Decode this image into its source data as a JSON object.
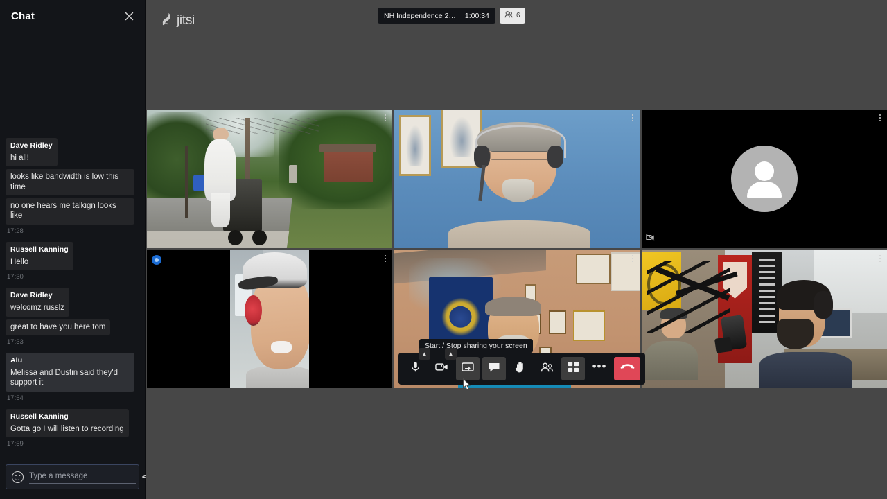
{
  "app": {
    "name": "Jitsi Meet",
    "brand_label": "jitsi",
    "brand_icon": "jitsi-logo-icon"
  },
  "chat": {
    "title": "Chat",
    "close_icon": "close-icon",
    "emoji_icon": "emoji-icon",
    "send_icon": "send-icon",
    "input": {
      "value": "",
      "placeholder": "Type a message"
    },
    "groups": [
      {
        "author": "Dave Ridley",
        "messages": [
          "hi all!",
          "looks like bandwidth is low this time",
          "no one hears me talkign looks like"
        ],
        "time": "17:28",
        "highlight": false
      },
      {
        "author": "Russell Kanning",
        "messages": [
          "Hello"
        ],
        "time": "17:30",
        "highlight": false
      },
      {
        "author": "Dave Ridley",
        "messages": [
          "welcomz russlz",
          "great to have you here tom"
        ],
        "time": "17:33",
        "highlight": false
      },
      {
        "author": "Alu",
        "messages": [
          "Melissa and Dustin said they'd support it"
        ],
        "time": "17:54",
        "highlight": true
      },
      {
        "author": "Russell Kanning",
        "messages": [
          "Gotta go I will listen to recording"
        ],
        "time": "17:59",
        "highlight": false
      }
    ]
  },
  "header": {
    "subject": "NH Independence 2…",
    "timer": "1:00:34",
    "participants_count": "6",
    "participants_icon": "participants-icon"
  },
  "grid": {
    "tiles": [
      {
        "id": "tile-road-walker",
        "description": "outdoor road scene",
        "menu_icon": "more-options-icon",
        "camera_off": false,
        "badge": false
      },
      {
        "id": "tile-headset-man",
        "description": "man with headset on blue wall",
        "menu_icon": "more-options-icon",
        "camera_off": false,
        "badge": false
      },
      {
        "id": "tile-avatar",
        "description": "participant avatar camera off",
        "menu_icon": "more-options-icon",
        "camera_off": true,
        "badge": false,
        "camera_off_icon": "camera-off-icon"
      },
      {
        "id": "tile-mobile-cap",
        "description": "portrait mobile video man with cap",
        "menu_icon": "more-options-icon",
        "camera_off": false,
        "badge": true,
        "badge_icon": "connection-indicator-icon"
      },
      {
        "id": "tile-nh-flag-man",
        "description": "man in blue shirt with NH flag",
        "menu_icon": "more-options-icon",
        "camera_off": false,
        "badge": false
      },
      {
        "id": "tile-radio-studio",
        "description": "radio studio with two people",
        "menu_icon": "more-options-icon",
        "camera_off": false,
        "badge": false
      }
    ]
  },
  "toolbar": {
    "tooltip": "Start / Stop sharing your screen",
    "buttons": [
      {
        "name": "microphone-button",
        "icon": "microphone-icon",
        "label": "Mute / Unmute",
        "has_chevron": true,
        "active": false
      },
      {
        "name": "camera-button",
        "icon": "camera-icon",
        "label": "Start / Stop camera",
        "has_chevron": true,
        "active": false
      },
      {
        "name": "screenshare-button",
        "icon": "screen-share-icon",
        "label": "Start / Stop sharing your screen",
        "has_chevron": false,
        "active": true
      },
      {
        "name": "chat-button",
        "icon": "chat-icon",
        "label": "Open / Close chat",
        "has_chevron": false,
        "active": true
      },
      {
        "name": "raise-hand-button",
        "icon": "raise-hand-icon",
        "label": "Raise / Lower your hand",
        "has_chevron": false,
        "active": false
      },
      {
        "name": "participants-button",
        "icon": "participants-icon",
        "label": "Participants",
        "has_chevron": false,
        "active": false
      },
      {
        "name": "tile-view-button",
        "icon": "tile-view-icon",
        "label": "Toggle tile view",
        "has_chevron": false,
        "active": true
      },
      {
        "name": "more-options-button",
        "icon": "ellipsis-icon",
        "label": "More actions",
        "has_chevron": false,
        "active": false
      },
      {
        "name": "hangup-button",
        "icon": "hangup-icon",
        "label": "Leave the meeting",
        "has_chevron": false,
        "active": false
      }
    ]
  },
  "colors": {
    "panel_bg": "#131519",
    "stage_bg": "#474747",
    "accent_blue": "#1b6cd4",
    "hangup_red": "#e04757",
    "bubble_bg": "#242528"
  }
}
